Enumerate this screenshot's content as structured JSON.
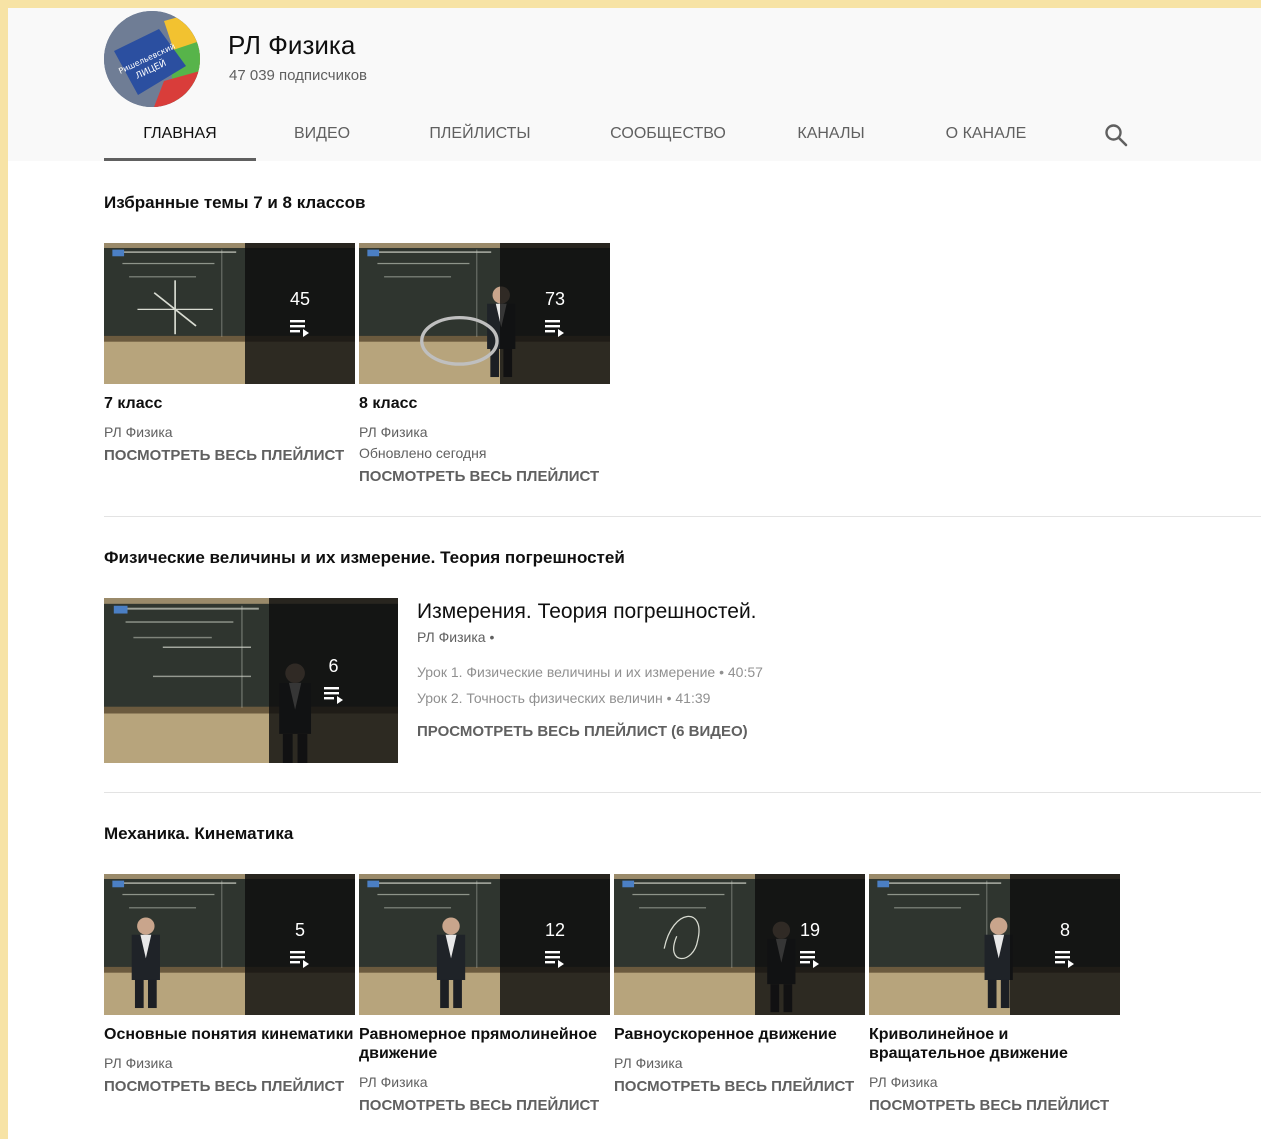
{
  "channel": {
    "title": "РЛ Физика",
    "subscribers": "47 039 подписчиков",
    "avatar_text_1": "Ришельевский",
    "avatar_text_2": "ЛИЦЕЙ"
  },
  "tabs": [
    {
      "label": "Главная",
      "active": true
    },
    {
      "label": "Видео"
    },
    {
      "label": "Плейлисты"
    },
    {
      "label": "Сообщество"
    },
    {
      "label": "Каналы"
    },
    {
      "label": "О канале"
    }
  ],
  "icons": {
    "search": "search-icon",
    "playlist": "playlist-icon"
  },
  "sections": [
    {
      "title": "Избранные темы 7 и 8 классов",
      "cards": [
        {
          "title": "7 класс",
          "channel": "РЛ Физика",
          "updated": "",
          "count": "45",
          "link": "Посмотреть весь плейлист"
        },
        {
          "title": "8 класс",
          "channel": "РЛ Физика",
          "updated": "Обновлено сегодня",
          "count": "73",
          "link": "Посмотреть весь плейлист"
        }
      ]
    },
    {
      "title": "Физические величины и их измерение. Теория погрешностей",
      "featured": {
        "title": "Измерения. Теория погрешностей.",
        "channel": "РЛ Физика •",
        "count": "6",
        "items": [
          "Урок 1. Физические величины и их измерение • 40:57",
          "Урок 2. Точность физических величин • 41:39"
        ],
        "link": "ПРОСМОТРЕТЬ ВЕСЬ ПЛЕЙЛИСТ (6 ВИДЕО)"
      }
    },
    {
      "title": "Механика. Кинематика",
      "cards": [
        {
          "title": "Основные понятия кинематики",
          "channel": "РЛ Физика",
          "count": "5",
          "link": "Посмотреть весь плейлист"
        },
        {
          "title": "Равномерное прямолинейное движение",
          "channel": "РЛ Физика",
          "count": "12",
          "link": "Посмотреть весь плейлист"
        },
        {
          "title": "Равноускоренное движение",
          "channel": "РЛ Физика",
          "count": "19",
          "link": "Посмотреть весь плейлист"
        },
        {
          "title": "Криволинейное и вращательное движение",
          "channel": "РЛ Физика",
          "count": "8",
          "link": "Посмотреть весь плейлист"
        }
      ]
    }
  ],
  "colors": {
    "background_outer": "#f7e3a5",
    "header_bg": "#f9f9f9",
    "text_primary": "#0f0f0f",
    "text_secondary": "#606060",
    "chalkboard": "#2e342d"
  }
}
